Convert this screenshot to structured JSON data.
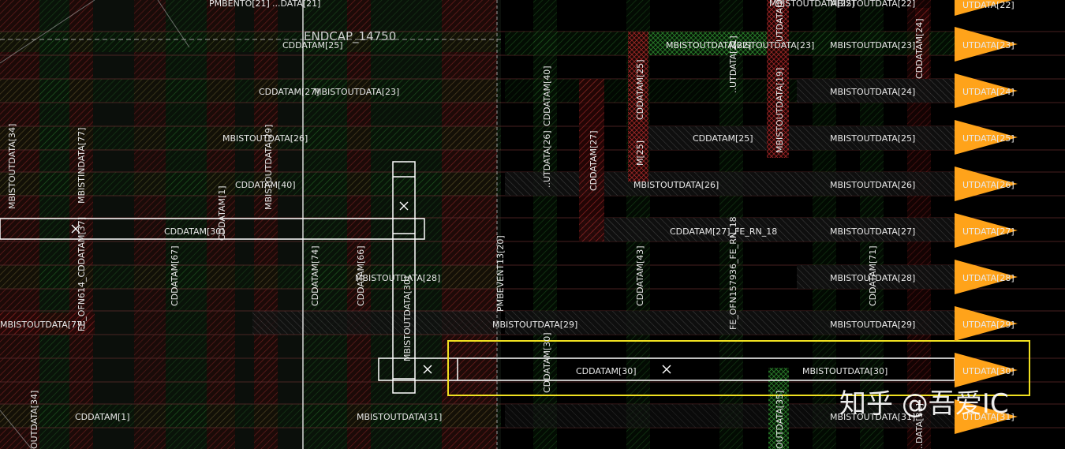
{
  "watermark": "知乎 @吾爱IC",
  "colors": {
    "background": "#000000",
    "red_hatch": "#b52a2a",
    "green_hatch": "#2f8a2f",
    "white_outline": "#ffffff",
    "selection": "#f0e020",
    "pin": "#ffa31a"
  },
  "labels": {
    "endcap": "ENDCAP_14750",
    "pmbento": "PMBENTO[21]",
    "top21": "...DATA[21]",
    "cddatam25_a": "CDDATAM[25]",
    "cddatam27": "CDDATAM[27]",
    "mbistoutdata23": "MBISTOUTDATA[23]",
    "mbistoutdata26_l": "MBISTOUTDATA[26]",
    "cddatam40": "CDDATAM[40]",
    "cddatam30_l": "CDDATAM[30]",
    "mbistoutdata28_l": "MBISTOUTDATA[28]",
    "mbistoutdata77": "MBISTOUTDATA[77]",
    "mbistoutdata29_m": "MBISTOUTDATA[29]",
    "cddatam30_m": "CDDATAM[30]",
    "cddatam1": "CDDATAM[1]",
    "mbistoutdata31_m": "MBISTOUTDATA[31]",
    "mbistoutdata22_t": "MBISTOUTDATA[22]",
    "mbistoutdata22_ml": "MBISTOUTDATA[22]",
    "mbistoutdata23_b": "MBISTOUTDATA[23]",
    "mbistoutdata23_c": "MBISTOUTDATA[23]",
    "cddatam25_r": "CDDATAM[25]",
    "mbistoutdata26_m": "MBISTOUTDATA[26]",
    "cddatam27_fe": "CDDATAM[27]_FE_RN_18",
    "mbistoutdata30_r": "MBISTOUTDATA[30]",
    "r22": "MBISTOUTDATA[22]",
    "r23": "MBISTOUTDATA[23]",
    "r24": "MBISTOUTDATA[24]",
    "r25": "MBISTOUTDATA[25]",
    "r26": "MBISTOUTDATA[26]",
    "r27": "MBISTOUTDATA[27]",
    "r28": "MBISTOUTDATA[28]",
    "r29": "MBISTOUTDATA[29]",
    "r31": "MBISTOUTDATA[31]",
    "p22": "UTDATA[22]",
    "p23": "UTDATA[23]",
    "p24": "UTDATA[24]",
    "p25": "UTDATA[25]",
    "p26": "UTDATA[26]",
    "p27": "UTDATA[27]",
    "p28": "UTDATA[28]",
    "p29": "UTDATA[29]",
    "p30": "UTDATA[30]",
    "p31": "UTDATA[31]",
    "v_outdata34": "MBISTOUTDATA[34]",
    "v_indata77": "MBISTINDATA[77]",
    "v_ofn614": "FE_OFN614_CDDATAM[37]",
    "v_outdata34b": "OUTDATA[34]",
    "v_cddatam67": "CDDATAM[67]",
    "v_cddatam1": "CDDATAM[1]",
    "v_utdata29": "MBISTOUTDATA[29]",
    "v_cddatam74": "CDDATAM[74]",
    "v_cddatam66": "CDDATAM[66]",
    "v_outdata30": "MBISTOUTDATA[30]",
    "v_pmbevent": "PMBEVENT13[20]",
    "v_utdata26": "..UTDATA[26]",
    "v_cddatam40": "CDDATAM[40]",
    "v_cddatam27": "CDDATAM[27]",
    "v_cddatam25": "CDDATAM[25]",
    "v_m25": "M[25]",
    "v_cddatam43": "CDDATAM[43]",
    "v_cddatam30": "CDDATAM[30]",
    "v_fe_ofn157936": "FE_OFN157936_FE_RN_18",
    "v_utdata21": "..UTDATA[21]",
    "v_utdata22": "..UTDATA[22]",
    "v_mbistoutdata19": "MBISTOUTDATA[19]",
    "v_cddatam24": "CDDATAM[24]",
    "v_cddatam71": "CDDATAM[71]",
    "v_outdata35": "OUTDATA[35]",
    "v_data31": "..DATA[31]"
  }
}
